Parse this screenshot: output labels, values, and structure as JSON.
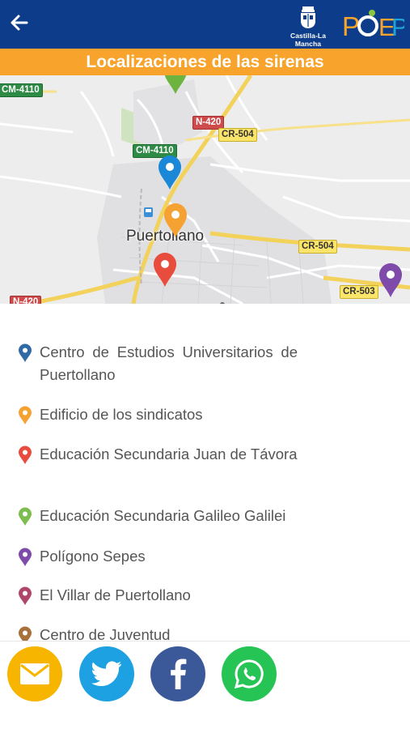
{
  "header": {
    "back_icon": "arrow-left-icon",
    "logo_region_text": "Castilla-La Mancha",
    "logo_brand_text": "PCEP",
    "colors": {
      "bar": "#0d3d8a",
      "brand_orange": "#f7a32c",
      "brand_blue": "#1fa2d6",
      "brand_green": "#8cc63f"
    }
  },
  "title": "Localizaciones de las sirenas",
  "map": {
    "city": "Puertollano",
    "road_labels": [
      "CM-4110",
      "N-420",
      "CR-504",
      "CM-4110",
      "CR-504",
      "CR-503",
      "N-420"
    ],
    "pins": [
      {
        "name": "blue",
        "color": "#1a88d6"
      },
      {
        "name": "orange",
        "color": "#f5a233"
      },
      {
        "name": "red",
        "color": "#e84c3d"
      },
      {
        "name": "purple",
        "color": "#7e4bab"
      },
      {
        "name": "green",
        "color": "#6cb33f"
      }
    ]
  },
  "locations": [
    {
      "label": "Centro de Estudios Universitarios de Puertollano",
      "color": "#2f6aa6"
    },
    {
      "label": "Edificio de los sindicatos",
      "color": "#f5a233"
    },
    {
      "label": "Educación Secundaria Juan de Távora",
      "color": "#e84c3d"
    },
    {
      "label": "Educación Secundaria Galileo Galilei",
      "color": "#7cbd4f"
    },
    {
      "label": "Polígono Sepes",
      "color": "#7e4bab"
    },
    {
      "label": "El Villar de Puertollano",
      "color": "#b0456a"
    },
    {
      "label": "Centro de Juventud",
      "color": "#a8713a"
    }
  ],
  "share": [
    {
      "name": "email",
      "icon": "envelope-icon",
      "color": "#f7b500"
    },
    {
      "name": "twitter",
      "icon": "twitter-bird-icon",
      "color": "#1da1e2"
    },
    {
      "name": "facebook",
      "icon": "facebook-f-icon",
      "color": "#3b5998"
    },
    {
      "name": "whatsapp",
      "icon": "whatsapp-icon",
      "color": "#25c455"
    }
  ]
}
